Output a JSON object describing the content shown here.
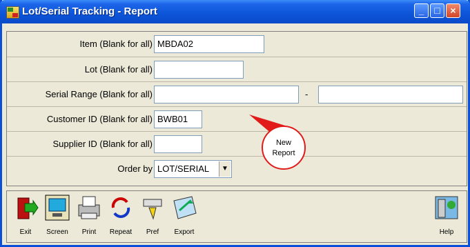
{
  "window": {
    "title": "Lot/Serial Tracking - Report"
  },
  "fields": {
    "item": {
      "label": "Item (Blank for all)",
      "value": "MBDA02"
    },
    "lot": {
      "label": "Lot (Blank for all)",
      "value": ""
    },
    "serial": {
      "label": "Serial Range (Blank for all)",
      "from": "",
      "to": "",
      "dash": "-"
    },
    "customer": {
      "label": "Customer ID (Blank for all)",
      "value": "BWB01"
    },
    "supplier": {
      "label": "Supplier ID (Blank for all)",
      "value": ""
    },
    "order_by": {
      "label": "Order by",
      "value": "LOT/SERIAL"
    }
  },
  "callout": {
    "line1": "New",
    "line2": "Report"
  },
  "toolbar": {
    "exit": "Exit",
    "screen": "Screen",
    "print": "Print",
    "repeat": "Repeat",
    "pref": "Pref",
    "export": "Export",
    "help": "Help"
  },
  "colors": {
    "title_bar": "#0a4ac8",
    "callout_red": "#e11a1a"
  }
}
